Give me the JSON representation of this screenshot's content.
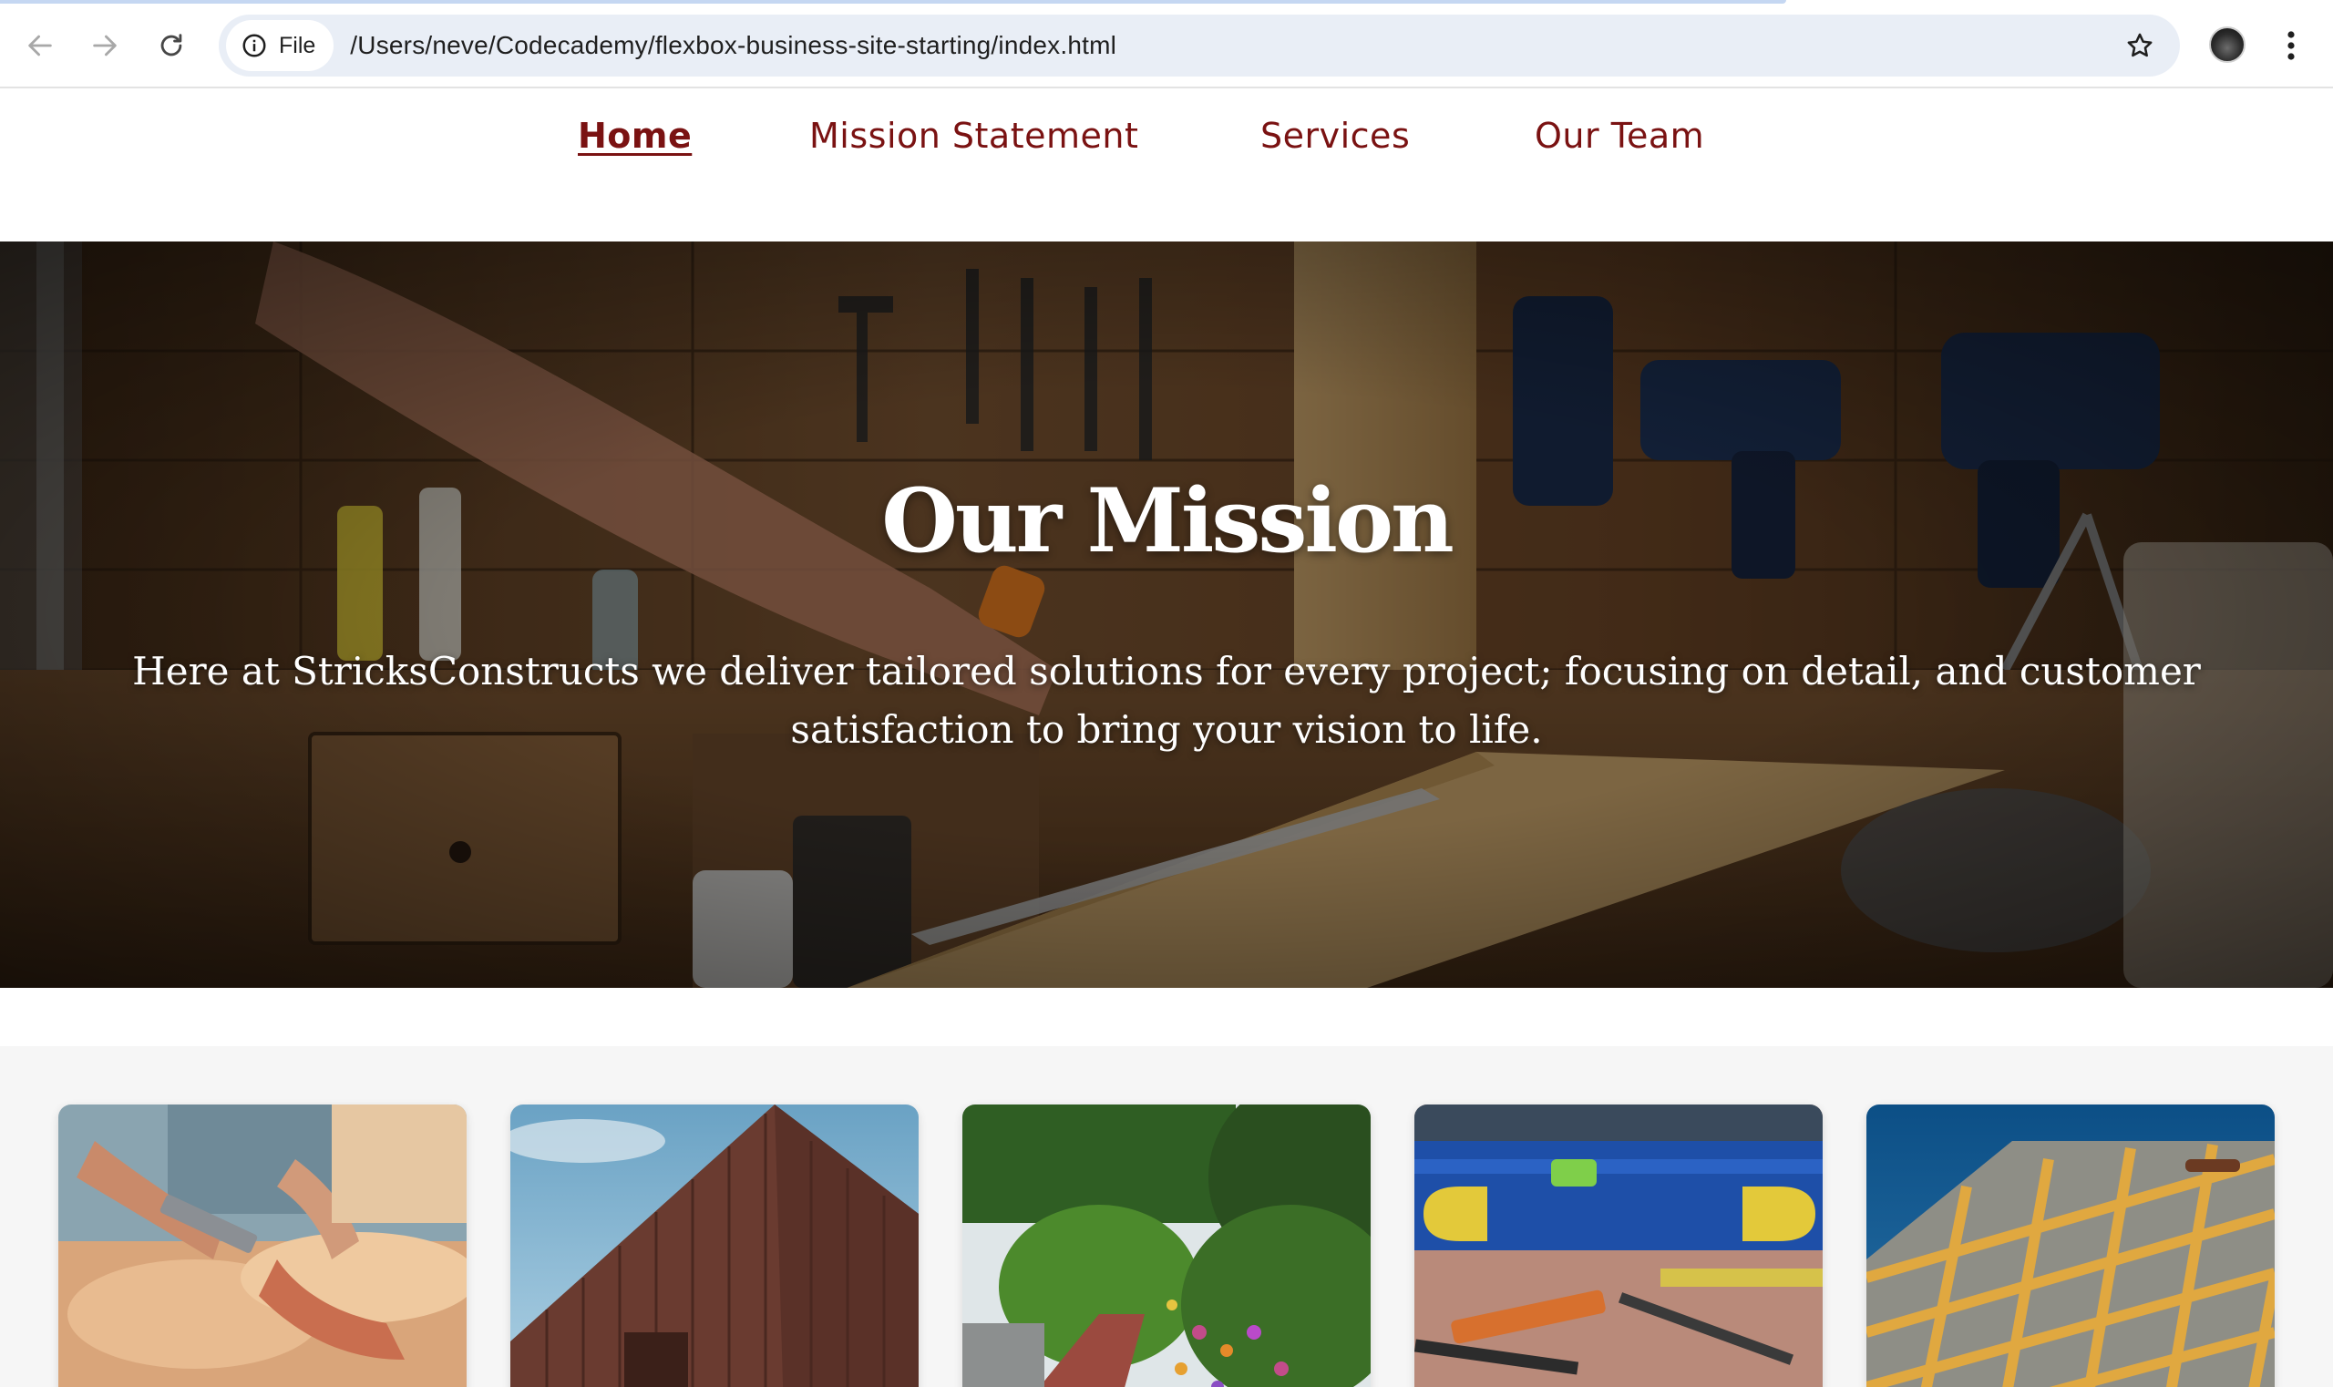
{
  "browser": {
    "site_chip_label": "File",
    "url": "/Users/neve/Codecademy/flexbox-business-site-starting/index.html",
    "icons": {
      "back": "arrow-left-icon",
      "forward": "arrow-right-icon",
      "reload": "reload-icon",
      "site_info": "info-icon",
      "bookmark": "star-icon",
      "profile": "avatar",
      "menu": "kebab-menu-icon"
    }
  },
  "nav": {
    "items": [
      {
        "label": "Home",
        "active": true
      },
      {
        "label": "Mission Statement",
        "active": false
      },
      {
        "label": "Services",
        "active": false
      },
      {
        "label": "Our Team",
        "active": false
      }
    ],
    "link_color": "#7a1212"
  },
  "hero": {
    "title": "Our Mission",
    "text": "Here at StricksConstructs we deliver tailored solutions for every project; focusing on detail, and customer satisfaction to bring your vision to life."
  },
  "gallery": {
    "images": [
      "wood-carving-image",
      "wooden-barn-image",
      "garden-path-image",
      "spirit-level-tools-image",
      "roof-frame-image"
    ]
  }
}
